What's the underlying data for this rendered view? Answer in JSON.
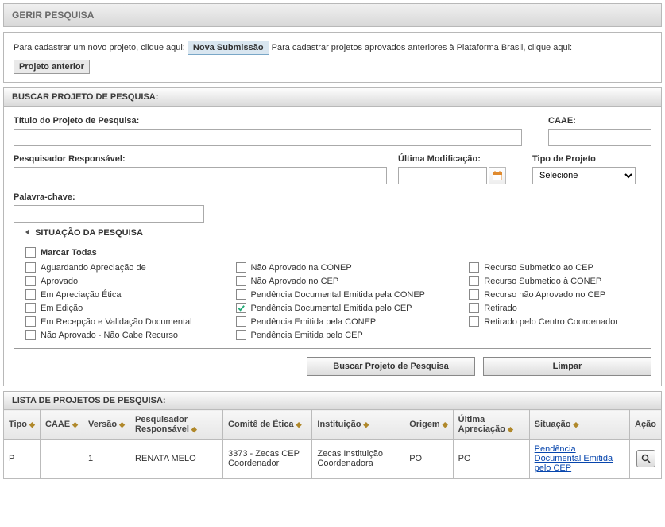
{
  "page": {
    "title": "GERIR PESQUISA"
  },
  "register": {
    "text1": "Para cadastrar um novo projeto, clique aqui:",
    "nova": "Nova Submissão",
    "text2": "Para cadastrar projetos aprovados anteriores à Plataforma Brasil, clique aqui:",
    "anterior": "Projeto anterior"
  },
  "search": {
    "header": "BUSCAR PROJETO DE PESQUISA:",
    "labels": {
      "titulo": "Título do Projeto de Pesquisa:",
      "caae": "CAAE:",
      "pesquisador": "Pesquisador Responsável:",
      "ultima_mod": "Última Modificação:",
      "tipo": "Tipo de Projeto",
      "palavra": "Palavra-chave:"
    },
    "tipo_selected": "Selecione",
    "situacao": {
      "legend": "SITUAÇÃO DA PESQUISA",
      "marcar_todas": "Marcar Todas",
      "col1": [
        "Aguardando Apreciação de",
        "Aprovado",
        "Em Apreciação Ética",
        "Em Edição",
        "Em Recepção e Validação Documental",
        "Não Aprovado - Não Cabe Recurso"
      ],
      "col2": [
        "Não Aprovado na CONEP",
        "Não Aprovado no CEP",
        "Pendência Documental Emitida pela CONEP",
        "Pendência Documental Emitida pelo CEP",
        "Pendência Emitida pela CONEP",
        "Pendência Emitida pelo CEP"
      ],
      "col3": [
        "Recurso Submetido ao CEP",
        "Recurso Submetido à CONEP",
        "Recurso não Aprovado no CEP",
        "Retirado",
        "Retirado pelo Centro Coordenador"
      ],
      "checked_col2_index": 3
    },
    "buttons": {
      "buscar": "Buscar Projeto de Pesquisa",
      "limpar": "Limpar"
    }
  },
  "lista": {
    "header": "LISTA DE PROJETOS DE PESQUISA:",
    "columns": [
      "Tipo",
      "CAAE",
      "Versão",
      "Pesquisador Responsável",
      "Comitê de Ética",
      "Instituição",
      "Origem",
      "Última Apreciação",
      "Situação",
      "Ação"
    ],
    "rows": [
      {
        "tipo": "P",
        "caae": "",
        "versao": "1",
        "pesquisador": "RENATA MELO",
        "comite": "3373 - Zecas CEP Coordenador",
        "instituicao": "Zecas Instituição Coordenadora",
        "origem": "PO",
        "ultima": "PO",
        "situacao": "Pendência Documental Emitida pelo CEP"
      }
    ]
  }
}
